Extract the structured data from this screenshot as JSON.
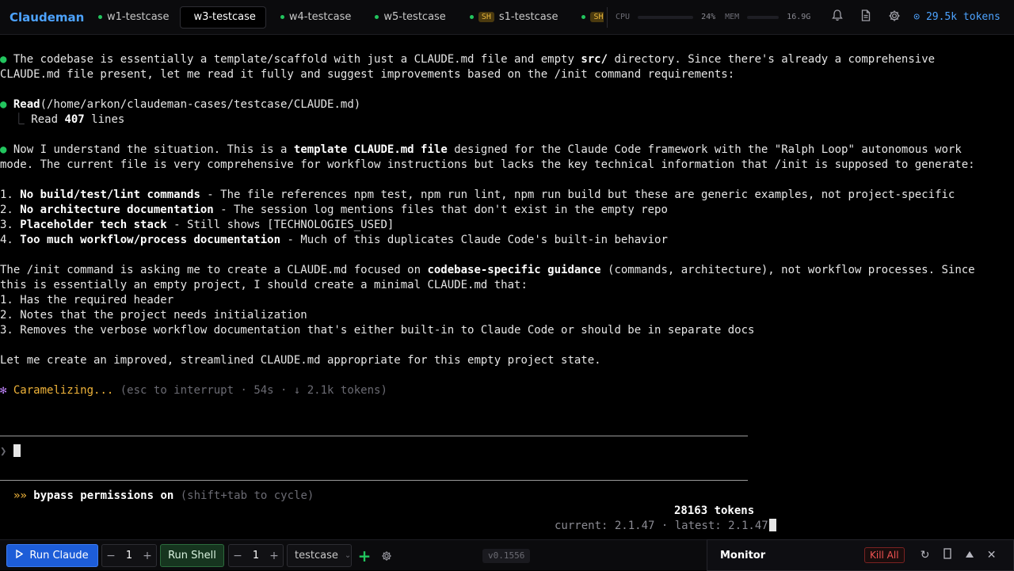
{
  "app": {
    "title": "Claudeman"
  },
  "tabs": [
    {
      "label": "w1-testcase",
      "type": "dot",
      "active": false
    },
    {
      "label": "w3-testcase",
      "type": "none",
      "active": true
    },
    {
      "label": "w4-testcase",
      "type": "dot",
      "active": false
    },
    {
      "label": "w5-testcase",
      "type": "dot",
      "active": false
    },
    {
      "label": "s1-testcase",
      "type": "sh",
      "badge": "SH",
      "active": false
    },
    {
      "label": "",
      "type": "sh",
      "badge": "SH",
      "active": false
    }
  ],
  "stats": {
    "cpu_label": "CPU",
    "cpu_value": "24%",
    "mem_label": "MEM",
    "mem_value": "16.9G"
  },
  "header": {
    "tokens": "29.5k tokens",
    "tokens_icon": "token-icon"
  },
  "terminal": {
    "p1_line1": "The codebase is essentially a template/scaffold with just a CLAUDE.md file and empty ",
    "p1_src": "src/",
    "p1_line1_end": " directory. Since there's already a comprehensive",
    "p1_line2": "CLAUDE.md file present, let me read it fully and suggest improvements based on the /init command requirements:",
    "read_tool": "Read",
    "read_path": "(/home/arkon/claudeman-cases/testcase/CLAUDE.md)",
    "read_result_prefix": "Read ",
    "read_result_count": "407",
    "read_result_suffix": " lines",
    "p2_a": "Now I understand the situation. This is a ",
    "p2_b": "template CLAUDE.md file",
    "p2_c": " designed for the Claude Code framework with the \"Ralph Loop\" autonomous work",
    "p2_line2": "mode. The current file is very comprehensive for workflow instructions but lacks the key technical information that /init is supposed to generate:",
    "issues": [
      {
        "num": "1. ",
        "title": "No build/test/lint commands",
        "text": " - The file references npm test, npm run lint, npm run build but these are generic examples, not project-specific"
      },
      {
        "num": "2. ",
        "title": "No architecture documentation",
        "text": " - The session log mentions files that don't exist in the empty repo"
      },
      {
        "num": "3. ",
        "title": "Placeholder tech stack",
        "text": " - Still shows [TECHNOLOGIES_USED]"
      },
      {
        "num": "4. ",
        "title": "Too much workflow/process documentation",
        "text": " - Much of this duplicates Claude Code's built-in behavior"
      }
    ],
    "p3_a": "The /init command is asking me to create a CLAUDE.md focused on ",
    "p3_b": "codebase-specific guidance",
    "p3_c": " (commands, architecture), not workflow processes. Since",
    "p3_line2": "this is essentially an empty project, I should create a minimal CLAUDE.md that:",
    "plan": [
      "1. Has the required header",
      "2. Notes that the project needs initialization",
      "3. Removes the verbose workflow documentation that's either built-in to Claude Code or should be in separate docs"
    ],
    "p4": "Let me create an improved, streamlined CLAUDE.md appropriate for this empty project state.",
    "status_glyph": "✻",
    "status_word": "Caramelizing...",
    "status_hint": "(esc to interrupt · 54s · ↓ 2.1k tokens)",
    "prompt_glyph": "❯",
    "mode_glyph": "»»",
    "mode_text": "bypass permissions on",
    "mode_hint": "(shift+tab to cycle)",
    "token_count": "28163 tokens",
    "version_line": "current: 2.1.47 · latest: 2.1.47"
  },
  "bottombar": {
    "run_claude": "Run Claude",
    "claude_count": "1",
    "run_shell": "Run Shell",
    "shell_count": "1",
    "case_select": "testcase",
    "version": "v0.1556"
  },
  "monitor": {
    "title": "Monitor",
    "kill_all": "Kill All"
  },
  "colors": {
    "accent": "#4da3ff",
    "run_button": "#1d5dd8",
    "shell_button": "#16351f",
    "status_dot": "#22c55e",
    "warning": "#f0b43a",
    "danger": "#f05252"
  }
}
